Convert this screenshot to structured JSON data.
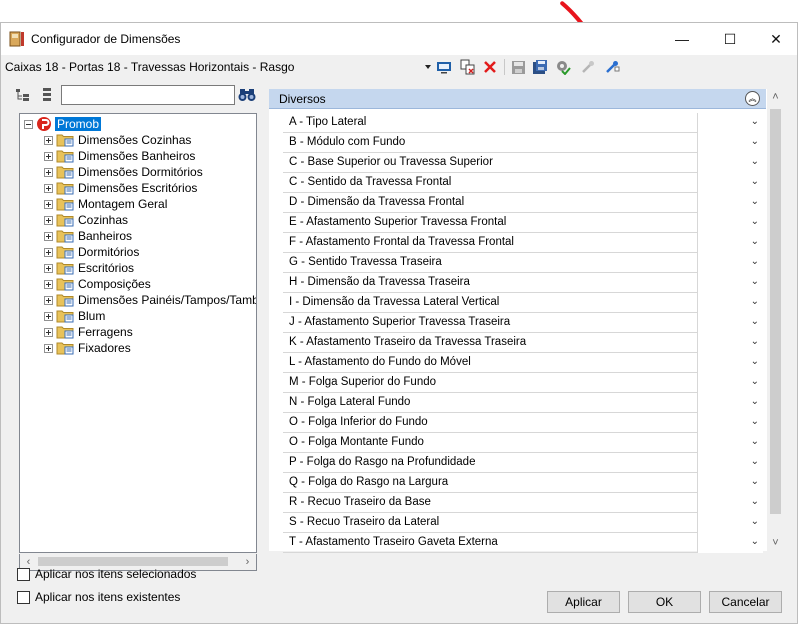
{
  "window": {
    "title": "Configurador de Dimensões",
    "minimize_glyph": "—",
    "maximize_glyph": "☐",
    "close_glyph": "✕"
  },
  "toolbar": {
    "config_path": "Caixas 18 - Portas 18 - Travessas Horizontais - Rasgo",
    "icons": [
      "dropdown-icon",
      "screen-icon",
      "copy-delete-icon",
      "delete-x-icon",
      "save-icon",
      "save-all-icon",
      "gear-check-icon",
      "wrench-disabled-icon",
      "wrench-icon"
    ]
  },
  "search": {
    "value": "",
    "placeholder": ""
  },
  "tree": {
    "root_label": "Promob",
    "items": [
      {
        "label": "Dimensões Cozinhas"
      },
      {
        "label": "Dimensões Banheiros"
      },
      {
        "label": "Dimensões Dormitórios"
      },
      {
        "label": "Dimensões Escritórios"
      },
      {
        "label": "Montagem Geral"
      },
      {
        "label": "Cozinhas"
      },
      {
        "label": "Banheiros"
      },
      {
        "label": "Dormitórios"
      },
      {
        "label": "Escritórios"
      },
      {
        "label": "Composições"
      },
      {
        "label": "Dimensões Painéis/Tampos/Tamburato"
      },
      {
        "label": "Blum"
      },
      {
        "label": "Ferragens"
      },
      {
        "label": "Fixadores"
      }
    ]
  },
  "options": {
    "apply_selected": "Aplicar nos itens selecionados",
    "apply_existing": "Aplicar nos itens existentes"
  },
  "properties": {
    "group_title": "Diversos",
    "rows": [
      {
        "label": "A - Tipo Lateral",
        "value": ""
      },
      {
        "label": "B - Módulo com Fundo",
        "value": ""
      },
      {
        "label": "C - Base Superior ou Travessa Superior",
        "value": ""
      },
      {
        "label": "C - Sentido da Travessa Frontal",
        "value": ""
      },
      {
        "label": "D - Dimensão da Travessa Frontal",
        "value": ""
      },
      {
        "label": "E - Afastamento Superior Travessa Frontal",
        "value": ""
      },
      {
        "label": "F - Afastamento Frontal da Travessa Frontal",
        "value": ""
      },
      {
        "label": "G - Sentido Travessa Traseira",
        "value": ""
      },
      {
        "label": "H - Dimensão da Travessa Traseira",
        "value": ""
      },
      {
        "label": "I - Dimensão da Travessa Lateral Vertical",
        "value": ""
      },
      {
        "label": "J - Afastamento Superior Travessa Traseira",
        "value": ""
      },
      {
        "label": "K - Afastamento Traseiro da Travessa Traseira",
        "value": ""
      },
      {
        "label": "L - Afastamento do Fundo do Móvel",
        "value": ""
      },
      {
        "label": "M - Folga Superior do Fundo",
        "value": ""
      },
      {
        "label": "N - Folga Lateral Fundo",
        "value": ""
      },
      {
        "label": "O - Folga Inferior do Fundo",
        "value": ""
      },
      {
        "label": "O - Folga Montante Fundo",
        "value": ""
      },
      {
        "label": "P - Folga do Rasgo na Profundidade",
        "value": ""
      },
      {
        "label": "Q - Folga do Rasgo na Largura",
        "value": ""
      },
      {
        "label": "R - Recuo Traseiro da Base",
        "value": ""
      },
      {
        "label": "S - Recuo Traseiro da Lateral",
        "value": ""
      },
      {
        "label": "T - Afastamento Traseiro Gaveta Externa",
        "value": ""
      }
    ]
  },
  "buttons": {
    "apply": "Aplicar",
    "ok": "OK",
    "cancel": "Cancelar"
  },
  "colors": {
    "accent": "#0078d7",
    "group_header": "#c5d7ee",
    "annotation_arrow": "#e8141c"
  }
}
